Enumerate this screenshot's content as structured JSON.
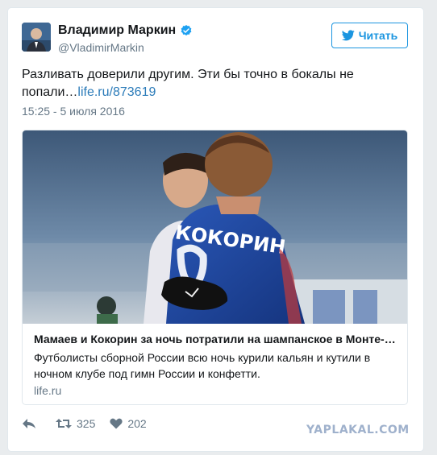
{
  "author": {
    "name": "Владимир Маркин",
    "handle": "@VladimirMarkin",
    "verified": true
  },
  "follow_button": {
    "label": "Читать",
    "icon": "twitter-bird-icon"
  },
  "tweet": {
    "text": "Разливать доверили другим. Эти бы точно в бокалы не попали…",
    "link": "life.ru/873619",
    "timestamp": "15:25 - 5 июля 2016"
  },
  "link_card": {
    "title": "Мамаев и Кокорин за ночь потратили на шампанское в Монте-…",
    "description": "Футболисты сборной России всю ночь курили кальян и кутили в ночном клубе под гимн России и конфетти.",
    "domain": "life.ru",
    "image_jersey_text": "КОКОРИН"
  },
  "actions": {
    "reply_icon": "reply-icon",
    "retweet_count": "325",
    "like_count": "202"
  },
  "watermark": "YAPLAKAL.COM",
  "colors": {
    "accent": "#1b95e0",
    "link": "#2b7bb9",
    "muted": "#657786"
  }
}
